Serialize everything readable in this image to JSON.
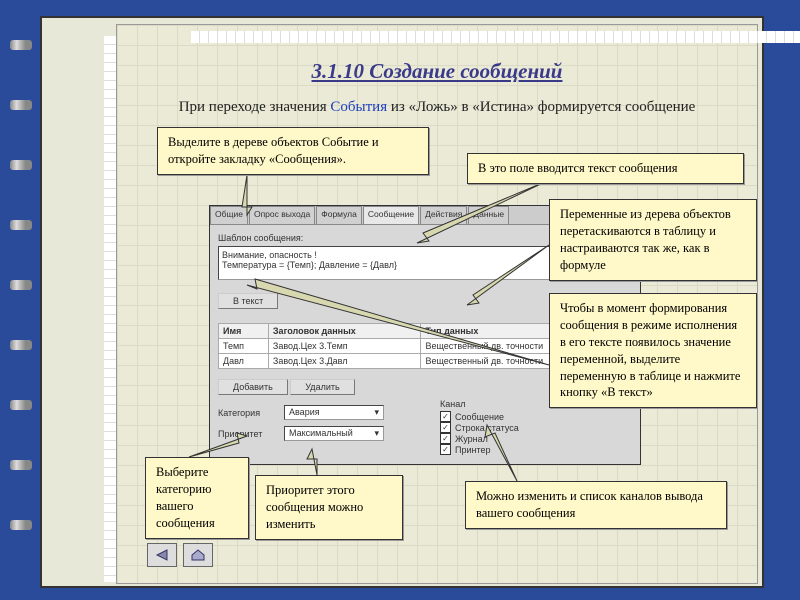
{
  "title": "3.1.10 Создание сообщений",
  "subtitle_pre": "При переходе  значения ",
  "subtitle_link": "События",
  "subtitle_post": " из «Ложь» в «Истина» формируется сообщение",
  "callouts": {
    "c1": "Выделите в дереве объектов Событие и откройте закладку «Сообщения».",
    "c2": "В это поле вводится текст сообщения",
    "c3": "Переменные из дерева объектов перетаскиваются в таблицу и настраиваются так же, как в формуле",
    "c4": "Чтобы в момент формирования сообщения в режиме исполнения в его тексте появилось значение переменной,  выделите переменную в таблице  и нажмите кнопку «В текст»",
    "c5": "Выберите категорию вашего сообщения",
    "c6": "Приоритет этого сообщения можно изменить",
    "c7": "Можно изменить и список каналов вывода вашего сообщения"
  },
  "tabs": [
    "Общие",
    "Опрос выхода",
    "Формула",
    "Сообщение",
    "Действия",
    "Данные"
  ],
  "template_label": "Шаблон сообщения:",
  "template_text": "Внимание, опасность !\nТемпература = {Темп}; Давление = {Давл}",
  "btn_vtext": "В текст",
  "table": {
    "headers": [
      "Имя",
      "Заголовок данных",
      "Тип данных"
    ],
    "rows": [
      [
        "Темп",
        "Завод.Цех 3.Темп",
        "Вещественный дв. точности"
      ],
      [
        "Давл",
        "Завод.Цех 3.Давл",
        "Вещественный дв. точности"
      ]
    ]
  },
  "btn_add": "Добавить",
  "btn_del": "Удалить",
  "category_label": "Категория",
  "category_value": "Авария",
  "priority_label": "Приоритет",
  "priority_value": "Максимальный",
  "channel_label": "Канал",
  "checks": [
    "Сообщение",
    "Строка статуса",
    "Журнал",
    "Принтер"
  ]
}
